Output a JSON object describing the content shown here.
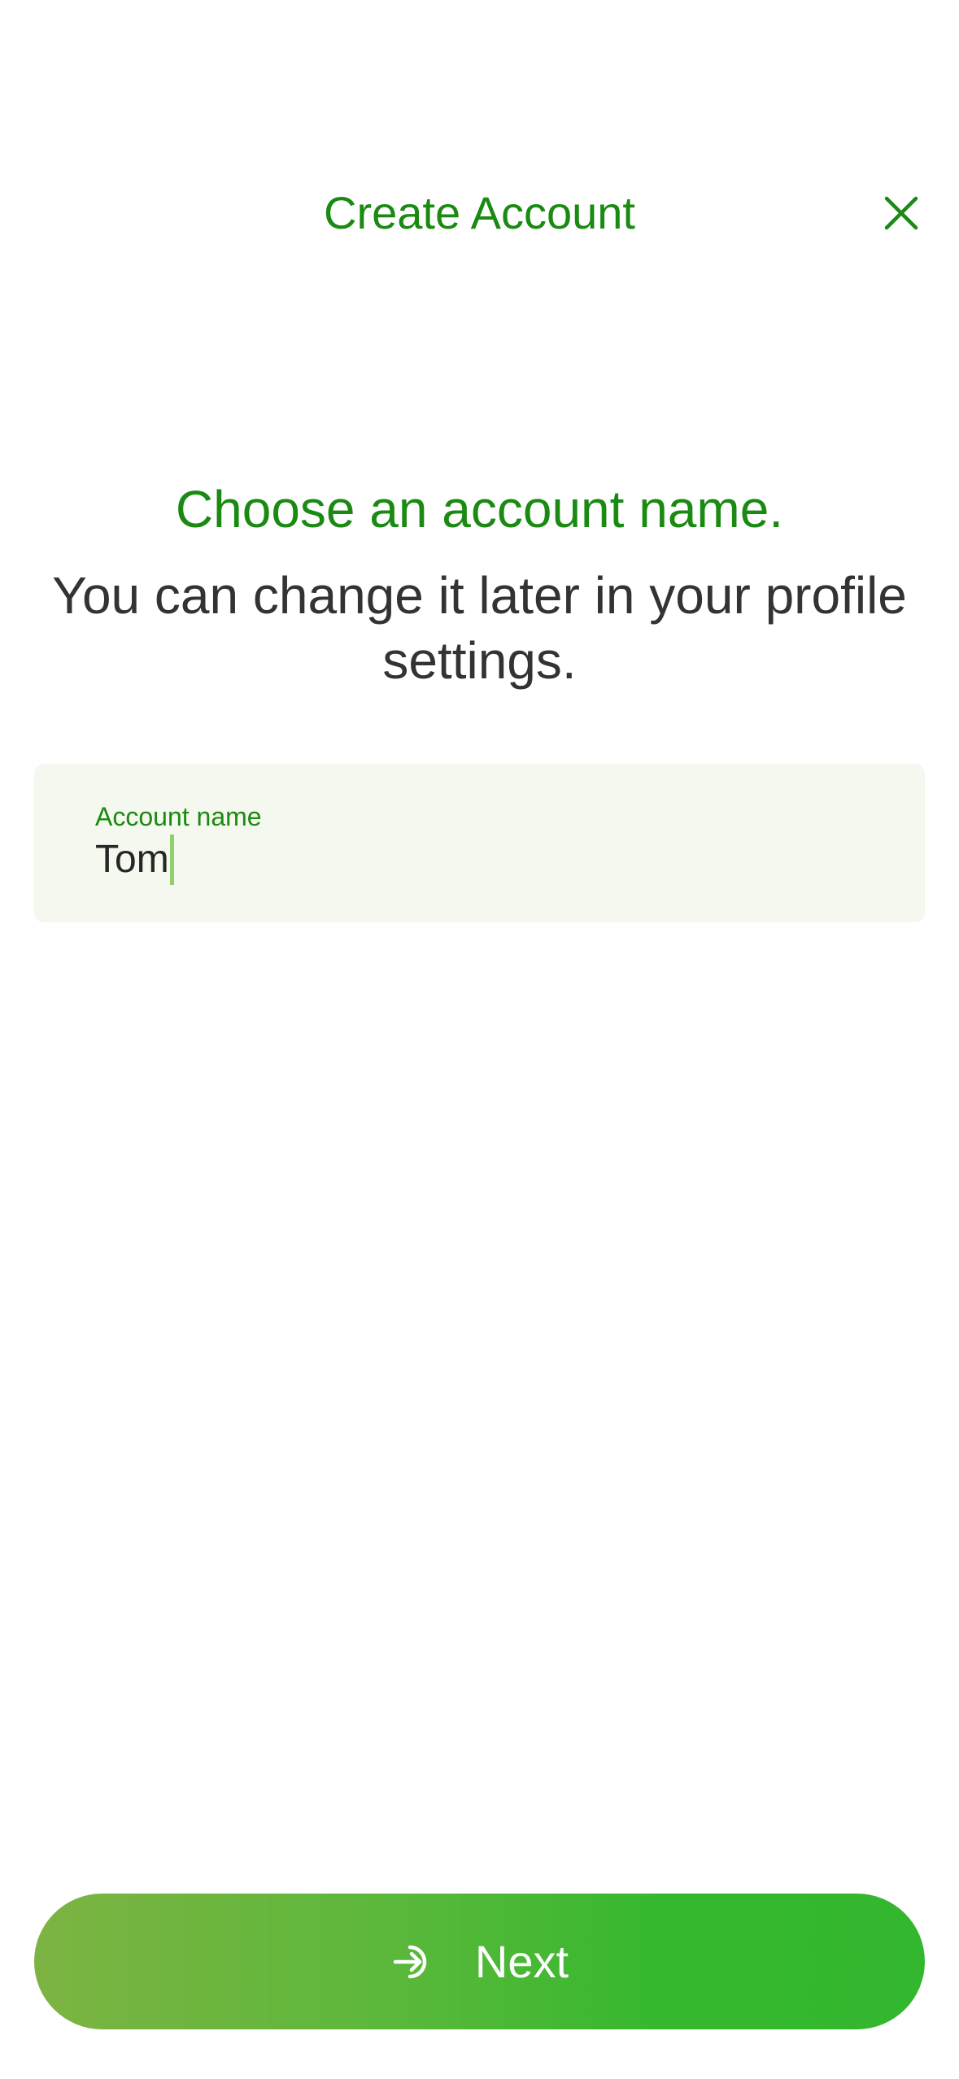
{
  "header": {
    "title": "Create Account",
    "close_icon": "close-icon"
  },
  "main": {
    "heading": "Choose an account name.",
    "subheading": "You can change it later in your profile settings.",
    "account_field": {
      "label": "Account name",
      "value": "Tom"
    }
  },
  "footer": {
    "next_label": "Next",
    "next_icon": "sign-in-arrow-icon"
  },
  "colors": {
    "accent": "#1a8a12",
    "field_background": "#f5f8ef",
    "button_gradient_start": "#7db342",
    "button_gradient_end": "#33b72e",
    "body_text": "#333333"
  }
}
